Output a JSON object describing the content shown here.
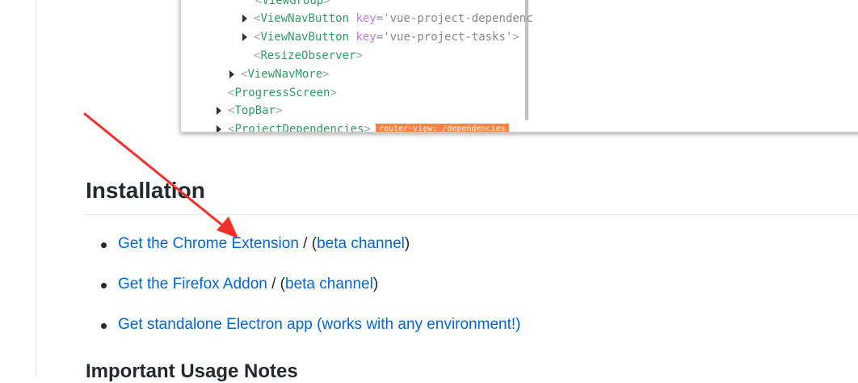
{
  "devtools_tree": {
    "lines": [
      {
        "indent": 1,
        "expandable": false,
        "tag": "",
        "partial": "ViewGroup"
      },
      {
        "indent": 2,
        "expandable": true,
        "tag": "ViewNavButton",
        "attr_key": "key",
        "attr_val": "'vue-project-dependenc"
      },
      {
        "indent": 2,
        "expandable": true,
        "tag": "ViewNavButton",
        "attr_key": "key",
        "attr_val": "'vue-project-tasks'"
      },
      {
        "indent": 2,
        "expandable": false,
        "tag": "ResizeObserver"
      },
      {
        "indent": 1,
        "expandable": true,
        "tag": "ViewNavMore"
      },
      {
        "indent": 1,
        "expandable": false,
        "tag": "ProgressScreen"
      },
      {
        "indent": 0,
        "expandable": true,
        "tag": "TopBar"
      },
      {
        "indent": 0,
        "expandable": true,
        "tag": "ProjectDependencies",
        "badge": "router-view: /dependencies"
      }
    ],
    "badge_color": "#ff8344"
  },
  "installation": {
    "heading": "Installation",
    "items": [
      {
        "link": "Get the Chrome Extension",
        "sep": " / (",
        "beta": "beta channel",
        "close": ")"
      },
      {
        "link": "Get the Firefox Addon",
        "sep": " / (",
        "beta": "beta channel",
        "close": ")"
      },
      {
        "link": "Get standalone Electron app (works with any environment!)"
      }
    ]
  },
  "usage_notes": {
    "heading": "Important Usage Notes"
  },
  "colors": {
    "link": "#0366d6",
    "text": "#24292e",
    "annotation_arrow": "#f0302b"
  }
}
